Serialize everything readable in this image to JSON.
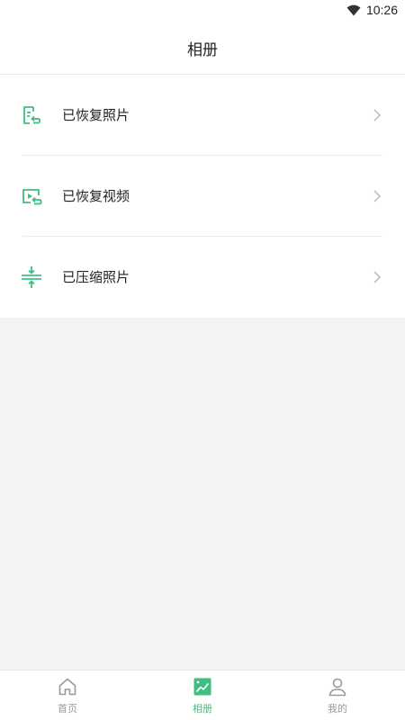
{
  "status_bar": {
    "time": "10:26"
  },
  "header": {
    "title": "相册"
  },
  "menu": {
    "items": [
      {
        "label": "已恢复照片",
        "icon": "restored-photos-icon"
      },
      {
        "label": "已恢复视频",
        "icon": "restored-videos-icon"
      },
      {
        "label": "已压缩照片",
        "icon": "compressed-photos-icon"
      }
    ]
  },
  "tabs": [
    {
      "label": "首页",
      "icon": "home-icon",
      "active": false
    },
    {
      "label": "相册",
      "icon": "album-icon",
      "active": true
    },
    {
      "label": "我的",
      "icon": "user-icon",
      "active": false
    }
  ],
  "colors": {
    "accent": "#3fbf7f",
    "background": "#f3f3f3",
    "inactive": "#999999"
  }
}
